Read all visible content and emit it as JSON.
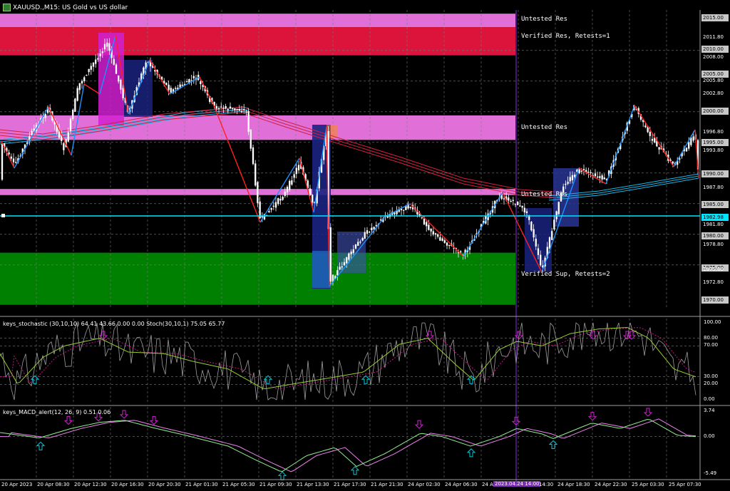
{
  "chart_title": "XAUUSD.,M15: US Gold vs US dollar",
  "colors": {
    "background": "#000000",
    "grid": "#7a7a7a",
    "untested_res": "#e070d8",
    "verified_res": "#dc143c",
    "verified_sup": "#008000",
    "zigzag_up": "#1e90ff",
    "zigzag_down": "#ff2020",
    "ma_red": "#d02040",
    "ma_blue": "#19b7e6",
    "current_line": "#00e5ff",
    "vline": "#8a2be2",
    "stoch_main": "#9acd32",
    "stoch_signal": "#c71585",
    "macd_main": "#90ee90",
    "macd_signal": "#ee82ee",
    "arrow_up": "#00c8d8",
    "arrow_down": "#d020d0"
  },
  "zones": [
    {
      "label": "Untested Res",
      "top": 2016.0,
      "bottom": 2013.8,
      "color": "#e070d8"
    },
    {
      "label": "Verified Res, Retests=1",
      "top": 2013.8,
      "bottom": 2009.2,
      "color": "#dc143c"
    },
    {
      "label": "Untested Res",
      "top": 1999.4,
      "bottom": 1995.4,
      "color": "#e070d8"
    },
    {
      "label": "Untested Res",
      "top": 1987.4,
      "bottom": 1986.4,
      "color": "#e070d8"
    },
    {
      "label": "Verified Sup, Retests=2",
      "top": 1977.0,
      "bottom": 1968.5,
      "color": "#008000"
    }
  ],
  "price_axis": [
    {
      "value": "2015.00",
      "highlight": true
    },
    {
      "value": "2011.80",
      "highlight": false
    },
    {
      "value": "2010.00",
      "highlight": true
    },
    {
      "value": "2008.00",
      "highlight": false
    },
    {
      "value": "2005.00",
      "highlight": true
    },
    {
      "value": "2005.80",
      "highlight": false
    },
    {
      "value": "2002.80",
      "highlight": false
    },
    {
      "value": "2000.00",
      "highlight": true
    },
    {
      "value": "1996.80",
      "highlight": false
    },
    {
      "value": "1995.00",
      "highlight": true
    },
    {
      "value": "1993.80",
      "highlight": false
    },
    {
      "value": "1990.00",
      "highlight": true
    },
    {
      "value": "1987.80",
      "highlight": false
    },
    {
      "value": "1985.00",
      "highlight": true
    },
    {
      "value": "1982.98",
      "highlight": "current"
    },
    {
      "value": "1981.80",
      "highlight": false
    },
    {
      "value": "1980.00",
      "highlight": true
    },
    {
      "value": "1978.80",
      "highlight": false
    },
    {
      "value": "1975.00",
      "highlight": true
    },
    {
      "value": "1975.80",
      "highlight": false
    },
    {
      "value": "1972.80",
      "highlight": false
    },
    {
      "value": "1970.00",
      "highlight": true
    }
  ],
  "stoch_panel": {
    "label": "keys_stochastic (30,10,10) 64.41 43.66 0.00 0.00 Stoch(30,10,1) 75.05 65.77",
    "axis": [
      "100.00",
      "80.00",
      "70.00",
      "30.00",
      "20.00",
      "0.00"
    ]
  },
  "macd_panel": {
    "label": "keys_MACD_alert(12, 26, 9) 0.51 0.06",
    "axis": [
      "3.74",
      "0.00",
      "-5.49"
    ]
  },
  "time_axis": [
    "20 Apr 2023",
    "20 Apr 08:30",
    "20 Apr 12:30",
    "20 Apr 16:30",
    "20 Apr 20:30",
    "21 Apr 01:30",
    "21 Apr 05:30",
    "21 Apr 09:30",
    "21 Apr 13:30",
    "21 Apr 17:30",
    "21 Apr 21:30",
    "24 Apr 02:30",
    "24 Apr 06:30",
    "24 A",
    "2023.04.24 14:00",
    "14:30",
    "24 Apr 18:30",
    "24 Apr 22:30",
    "25 Apr 03:30",
    "25 Apr 07:30"
  ]
}
